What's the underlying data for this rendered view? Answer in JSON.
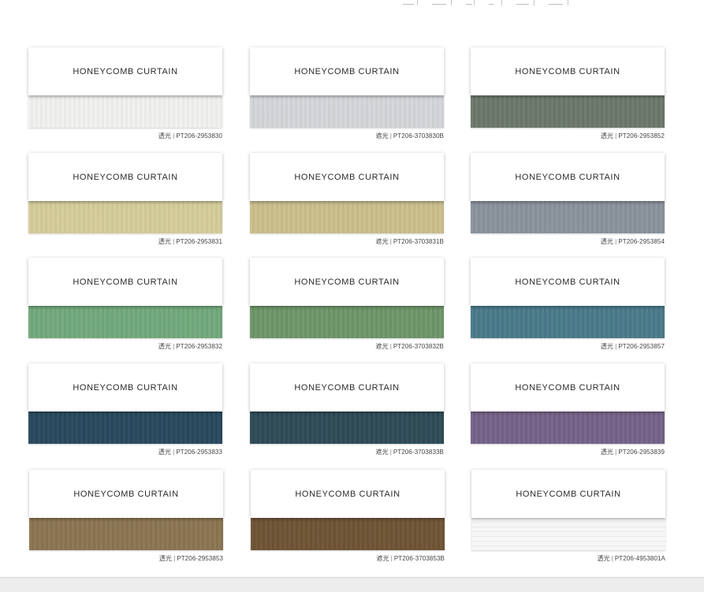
{
  "header_marks": [
    "",
    "",
    "",
    "",
    "",
    ""
  ],
  "cards": [
    {
      "title": "HONEYCOMB CURTAIN",
      "type": "透光",
      "code": "PT206-2953830",
      "color": "#f1f1ef"
    },
    {
      "title": "HONEYCOMB CURTAIN",
      "type": "遮光",
      "code": "PT206-3703830B",
      "color": "#d4d6d9"
    },
    {
      "title": "HONEYCOMB CURTAIN",
      "type": "透光",
      "code": "PT206-2953852",
      "color": "#6c776c"
    },
    {
      "title": "HONEYCOMB CURTAIN",
      "type": "透光",
      "code": "PT206-2953831",
      "color": "#d6cc9b"
    },
    {
      "title": "HONEYCOMB CURTAIN",
      "type": "遮光",
      "code": "PT206-3703831B",
      "color": "#cbbf8c"
    },
    {
      "title": "HONEYCOMB CURTAIN",
      "type": "透光",
      "code": "PT206-2953854",
      "color": "#8a929d"
    },
    {
      "title": "HONEYCOMB CURTAIN",
      "type": "透光",
      "code": "PT206-2953832",
      "color": "#71a97b"
    },
    {
      "title": "HONEYCOMB CURTAIN",
      "type": "遮光",
      "code": "PT206-3703832B",
      "color": "#6d9669"
    },
    {
      "title": "HONEYCOMB CURTAIN",
      "type": "透光",
      "code": "PT206-2953857",
      "color": "#4a7a8a"
    },
    {
      "title": "HONEYCOMB CURTAIN",
      "type": "透光",
      "code": "PT206-2953833",
      "color": "#28495e"
    },
    {
      "title": "HONEYCOMB CURTAIN",
      "type": "遮光",
      "code": "PT206-3703833B",
      "color": "#2d4b57"
    },
    {
      "title": "HONEYCOMB CURTAIN",
      "type": "透光",
      "code": "PT206-2953839",
      "color": "#76628a"
    },
    {
      "title": "HONEYCOMB CURTAIN",
      "type": "透光",
      "code": "PT206-2953853",
      "color": "#8b7552"
    },
    {
      "title": "HONEYCOMB CURTAIN",
      "type": "遮光",
      "code": "PT206-3703853B",
      "color": "#6f5435"
    },
    {
      "title": "HONEYCOMB CURTAIN",
      "type": "透光",
      "code": "PT206-4953801A",
      "color": "#f6f6f6"
    }
  ]
}
